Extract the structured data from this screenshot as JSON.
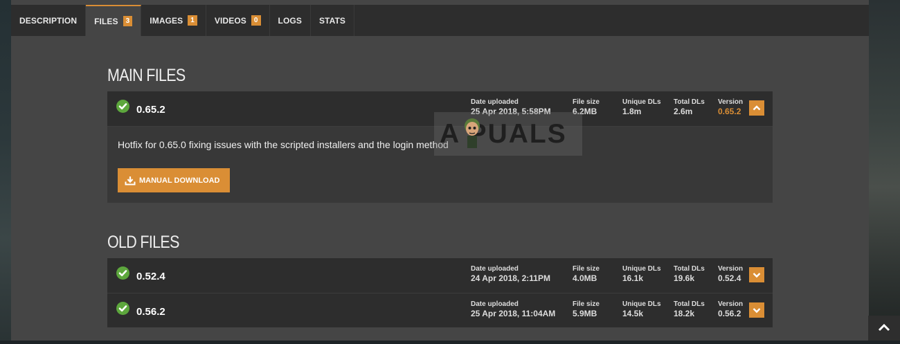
{
  "tabs": [
    {
      "label": "DESCRIPTION",
      "badge": null,
      "active": false
    },
    {
      "label": "FILES",
      "badge": "3",
      "active": true
    },
    {
      "label": "IMAGES",
      "badge": "1",
      "active": false
    },
    {
      "label": "VIDEOS",
      "badge": "0",
      "active": false
    },
    {
      "label": "LOGS",
      "badge": null,
      "active": false
    },
    {
      "label": "STATS",
      "badge": null,
      "active": false
    }
  ],
  "main_files": {
    "title": "MAIN FILES",
    "files": [
      {
        "name": "0.65.2",
        "date_label": "Date uploaded",
        "date": "25 Apr 2018, 5:58PM",
        "size_label": "File size",
        "size": "6.2MB",
        "unique_label": "Unique DLs",
        "unique": "1.8m",
        "total_label": "Total DLs",
        "total": "2.6m",
        "version_label": "Version",
        "version": "0.65.2",
        "expanded": true,
        "description": "Hotfix for 0.65.0 fixing issues with the scripted installers and the login method",
        "download_label": "MANUAL DOWNLOAD"
      }
    ]
  },
  "old_files": {
    "title": "OLD FILES",
    "files": [
      {
        "name": "0.52.4",
        "date_label": "Date uploaded",
        "date": "24 Apr 2018, 2:11PM",
        "size_label": "File size",
        "size": "4.0MB",
        "unique_label": "Unique DLs",
        "unique": "16.1k",
        "total_label": "Total DLs",
        "total": "19.6k",
        "version_label": "Version",
        "version": "0.52.4"
      },
      {
        "name": "0.56.2",
        "date_label": "Date uploaded",
        "date": "25 Apr 2018, 11:04AM",
        "size_label": "File size",
        "size": "5.9MB",
        "unique_label": "Unique DLs",
        "unique": "14.5k",
        "total_label": "Total DLs",
        "total": "18.2k",
        "version_label": "Version",
        "version": "0.56.2"
      }
    ]
  },
  "watermark": {
    "text": "A PUALS"
  },
  "icons": {
    "check": "check-circle-icon",
    "collapse": "chevron-up-icon",
    "expand": "chevron-down-icon",
    "download": "download-icon",
    "scroll_top": "chevron-up-icon"
  },
  "colors": {
    "accent": "#da8e35",
    "success": "#5da73d",
    "panel": "#454545",
    "row": "#2d2d2d"
  }
}
